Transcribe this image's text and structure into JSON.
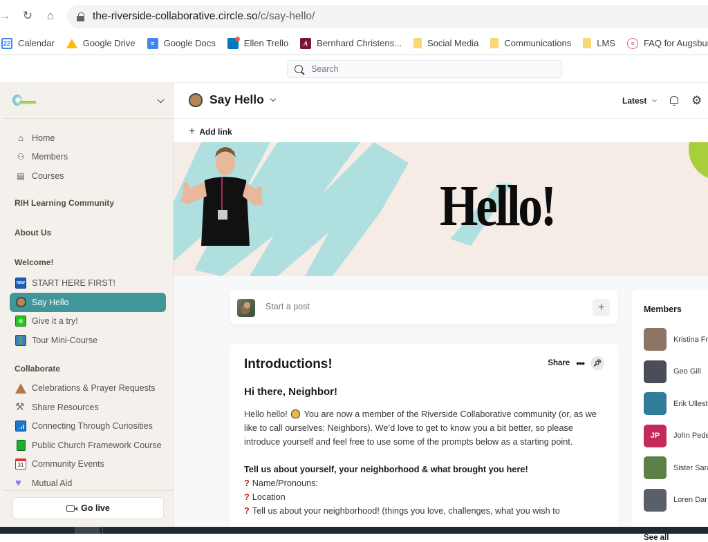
{
  "browser": {
    "url_host": "the-riverside-collaborative.circle.so",
    "url_path": "/c/say-hello/",
    "bookmarks": [
      {
        "label": "Calendar",
        "icon": "calendar-icon",
        "glyph": "22"
      },
      {
        "label": "Google Drive",
        "icon": "google-drive-icon",
        "glyph": ""
      },
      {
        "label": "Google Docs",
        "icon": "google-docs-icon",
        "glyph": "≡"
      },
      {
        "label": "Ellen Trello",
        "icon": "trello-icon",
        "glyph": ""
      },
      {
        "label": "Bernhard Christens...",
        "icon": "augsburg-icon",
        "glyph": "A"
      },
      {
        "label": "Social Media",
        "icon": "folder-icon",
        "glyph": ""
      },
      {
        "label": "Communications",
        "icon": "folder-icon",
        "glyph": ""
      },
      {
        "label": "LMS",
        "icon": "folder-icon",
        "glyph": ""
      },
      {
        "label": "FAQ for Augsburg S...",
        "icon": "faq-icon",
        "glyph": "≡"
      }
    ]
  },
  "header": {
    "search_placeholder": "Search"
  },
  "sidebar": {
    "nav": [
      {
        "label": "Home",
        "icon": "home-icon"
      },
      {
        "label": "Members",
        "icon": "members-icon"
      },
      {
        "label": "Courses",
        "icon": "courses-icon"
      }
    ],
    "sections": {
      "rih": "RIH Learning Community",
      "about": "About Us",
      "welcome": "Welcome!",
      "collaborate": "Collaborate"
    },
    "welcome_items": [
      {
        "label": "START HERE FIRST!",
        "icon": "new-badge-icon",
        "active": false
      },
      {
        "label": "Say Hello",
        "icon": "clapping-hands-icon",
        "active": true
      },
      {
        "label": "Give it a try!",
        "icon": "sparkle-icon",
        "active": false
      },
      {
        "label": "Tour Mini-Course",
        "icon": "map-icon",
        "active": false
      }
    ],
    "collaborate_items": [
      {
        "label": "Celebrations & Prayer Requests",
        "icon": "praying-hands-icon"
      },
      {
        "label": "Share Resources",
        "icon": "tools-icon"
      },
      {
        "label": "Connecting Through Curiosities",
        "icon": "signal-icon"
      },
      {
        "label": "Public Church Framework Course",
        "icon": "green-book-icon"
      },
      {
        "label": "Community Events",
        "icon": "calendar-icon",
        "glyph": "31"
      },
      {
        "label": "Mutual Aid",
        "icon": "purple-heart-icon"
      }
    ],
    "go_live_label": "Go live",
    "active_color": "#40979a"
  },
  "space": {
    "title": "Say Hello",
    "sort_label": "Latest",
    "add_link_label": "Add link"
  },
  "banner": {
    "headline": "Hello!"
  },
  "composer": {
    "placeholder": "Start a post",
    "add_glyph": "+"
  },
  "post": {
    "title": "Introductions!",
    "share_label": "Share",
    "subtitle": "Hi there, Neighbor!",
    "intro_before_emoji": "Hello hello!",
    "intro_after_emoji": " You are now a member of the Riverside Collaborative community (or, as we like to call ourselves: Neighbors). We’d love to get to know you a bit better, so please introduce yourself and feel free to use some of the prompts below as a starting point.",
    "prompt_heading": "Tell us about yourself, your neighborhood & what brought you here!",
    "prompts": [
      "Name/Pronouns:",
      "Location",
      "Tell us about your neighborhood! (things you love, challenges, what you wish to"
    ]
  },
  "members": {
    "title": "Members",
    "list": [
      {
        "name": "Kristina Fr",
        "initials": "",
        "color": "#8a7566"
      },
      {
        "name": "Geo Gill",
        "initials": "",
        "color": "#4a4f57"
      },
      {
        "name": "Erik Ullest",
        "initials": "",
        "color": "#2f7c9b"
      },
      {
        "name": "John Pede",
        "initials": "JP",
        "color": "#c22a58"
      },
      {
        "name": "Sister Sara",
        "initials": "",
        "color": "#5f7f49"
      },
      {
        "name": "Loren Dar",
        "initials": "",
        "color": "#5a6068"
      }
    ],
    "see_all_label": "See all"
  }
}
